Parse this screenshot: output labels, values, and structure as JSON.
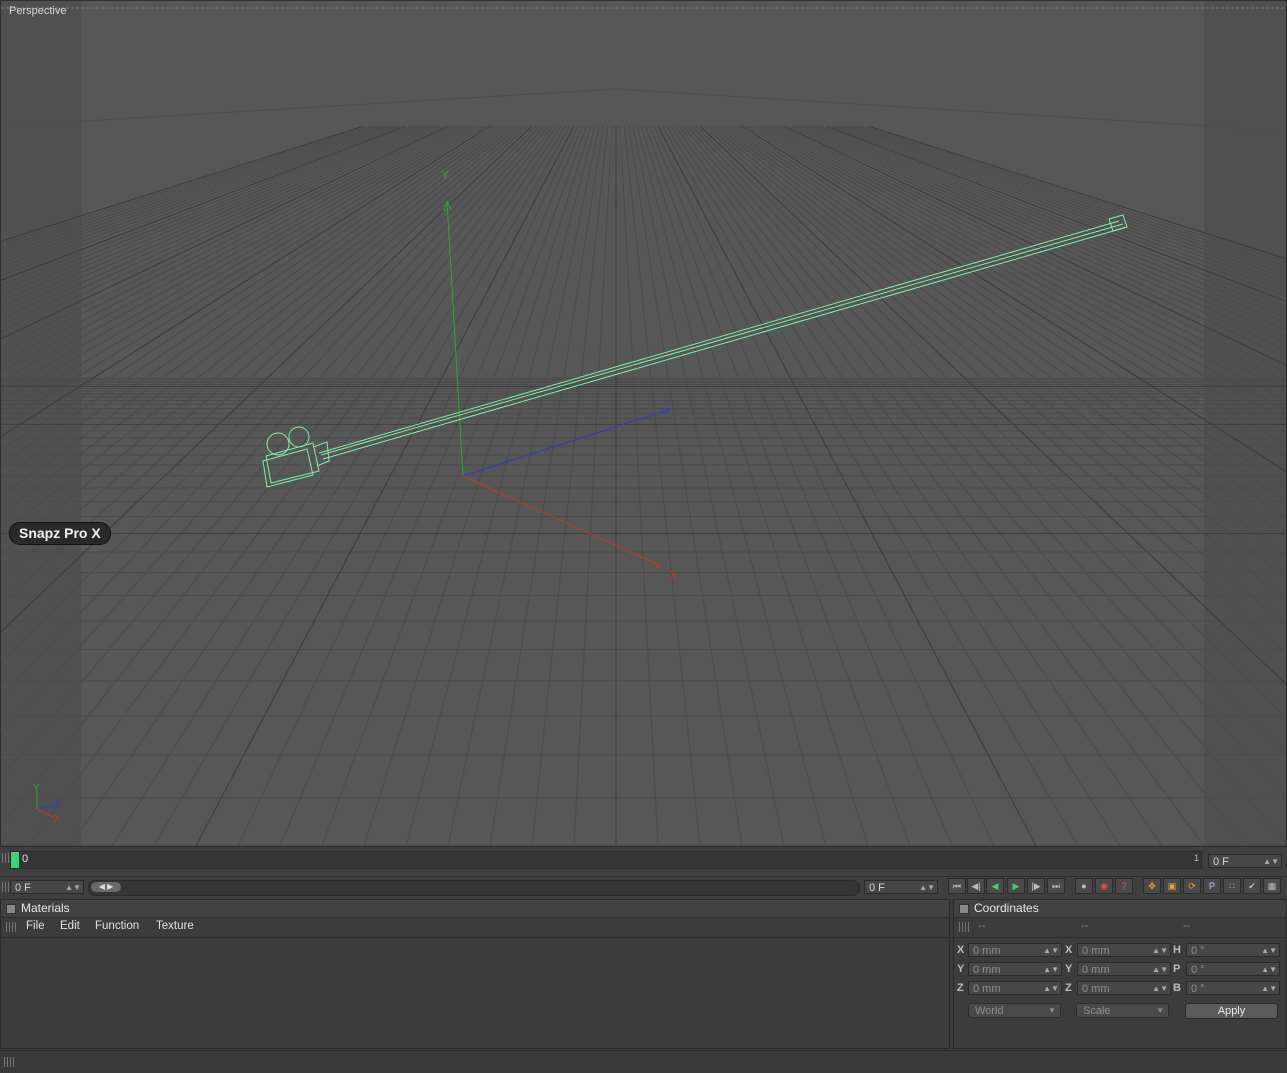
{
  "viewport": {
    "label": "Perspective",
    "overlay_badge": "Snapz Pro X",
    "axis_labels": {
      "y": "Y",
      "x": "X",
      "z": "Z"
    },
    "colors": {
      "background": "#565656",
      "grid": "#4a4a4a",
      "object_wire": "#7df0a8",
      "x_axis": "#c0392b",
      "y_axis": "#2ea83a",
      "z_axis": "#2b3dc8"
    }
  },
  "timeline": {
    "current_frame_marker": "0",
    "end_marker": "1",
    "end_field": "0 F"
  },
  "transport": {
    "start_field": "0 F",
    "current_field": "0 F",
    "nav_buttons": [
      "first-frame-icon",
      "prev-key-icon",
      "play-backward-icon",
      "play-forward-icon",
      "next-key-icon",
      "last-frame-icon"
    ],
    "record_buttons": [
      "record-keys-icon",
      "autokey-icon",
      "key-help-icon"
    ],
    "key_buttons": [
      "move-key-icon",
      "scale-key-icon",
      "rotate-key-icon",
      "param-key-icon",
      "pla-key-icon",
      "point-key-icon",
      "interp-key-icon"
    ]
  },
  "materials": {
    "title": "Materials",
    "menu": [
      "File",
      "Edit",
      "Function",
      "Texture"
    ]
  },
  "coordinates": {
    "title": "Coordinates",
    "headers": [
      "--",
      "--",
      "--"
    ],
    "rows": [
      {
        "a_label": "X",
        "a_value": "0 mm",
        "b_label": "X",
        "b_value": "0 mm",
        "c_label": "H",
        "c_value": "0 °"
      },
      {
        "a_label": "Y",
        "a_value": "0 mm",
        "b_label": "Y",
        "b_value": "0 mm",
        "c_label": "P",
        "c_value": "0 °"
      },
      {
        "a_label": "Z",
        "a_value": "0 mm",
        "b_label": "Z",
        "b_value": "0 mm",
        "c_label": "B",
        "c_value": "0 °"
      }
    ],
    "space_dropdown": "World",
    "mode_dropdown": "Scale",
    "apply_label": "Apply"
  }
}
